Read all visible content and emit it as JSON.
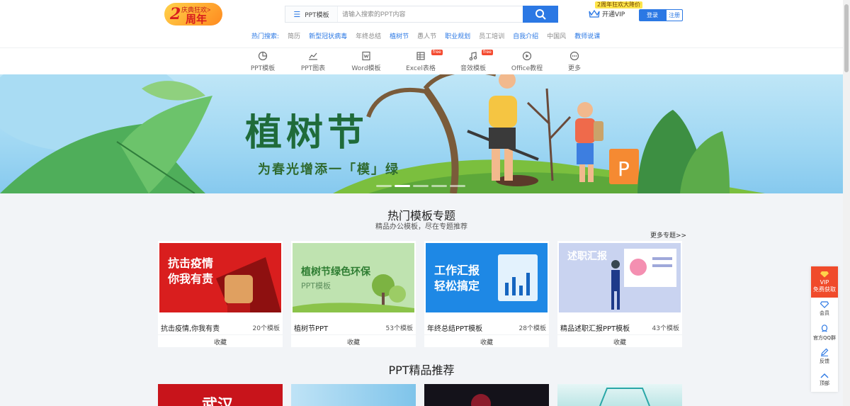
{
  "header": {
    "logo": {
      "num": "2",
      "small": "庆典狂欢>",
      "big": "周年"
    },
    "search": {
      "category": "PPT模板",
      "placeholder": "请输入搜索的PPT内容"
    },
    "vip_tip": "2周年狂欢大降价",
    "vip_label": "开通VIP",
    "login_label": "登录",
    "register_label": "注册",
    "hot_label": "热门搜索:",
    "hot_tags": [
      {
        "text": "简历",
        "blue": false
      },
      {
        "text": "新型冠状病毒",
        "blue": true
      },
      {
        "text": "年终总结",
        "blue": false
      },
      {
        "text": "植树节",
        "blue": true
      },
      {
        "text": "愚人节",
        "blue": false
      },
      {
        "text": "职业规划",
        "blue": true
      },
      {
        "text": "员工培训",
        "blue": false
      },
      {
        "text": "自我介绍",
        "blue": true
      },
      {
        "text": "中国风",
        "blue": false
      },
      {
        "text": "教师说课",
        "blue": true
      }
    ]
  },
  "nav": {
    "items": [
      "PPT模板",
      "PPT图表",
      "Word模板",
      "Excel表格",
      "音效模板",
      "Office教程",
      "更多"
    ],
    "free_badge": "free"
  },
  "banner": {
    "title": "植树节",
    "subtitle": "为春光增添一「模」绿"
  },
  "section_hot": {
    "title": "热门模板专题",
    "subtitle": "精品办公模板，尽在专题推荐",
    "more": "更多专题>>",
    "cards": [
      {
        "thumb_text": "抗击疫情\n你我有责",
        "name": "抗击疫情,你我有责",
        "count": "20个模板",
        "fav": "收藏"
      },
      {
        "thumb_text": "植树节绿色环保",
        "thumb_sub": "PPT模板",
        "name": "植树节PPT",
        "count": "53个模板",
        "fav": "收藏"
      },
      {
        "thumb_text": "工作汇报\n轻松搞定",
        "name": "年终总结PPT模板",
        "count": "28个模板",
        "fav": "收藏"
      },
      {
        "thumb_text": "述职汇报",
        "name": "精品述职汇报PPT模板",
        "count": "43个模板",
        "fav": "收藏"
      }
    ]
  },
  "section_ppt": {
    "title": "PPT精品推荐",
    "first_card_text": "武汉"
  },
  "side": {
    "vip_line1": "VIP",
    "vip_line2": "免费获取",
    "items": [
      "会员",
      "官方QQ群",
      "反馈",
      "顶部"
    ]
  },
  "colors": {
    "primary": "#2b78e4",
    "accent": "#f04b2b",
    "page_bg": "#f2f4f7"
  }
}
